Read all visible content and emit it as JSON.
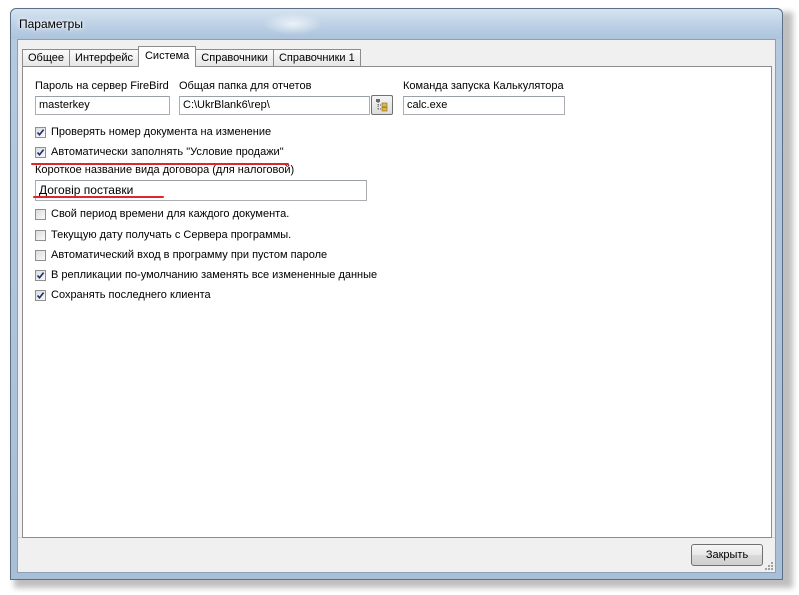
{
  "window": {
    "title": "Параметры"
  },
  "tabs": [
    {
      "label": "Общее",
      "active": false
    },
    {
      "label": "Интерфейс",
      "active": false
    },
    {
      "label": "Система",
      "active": true
    },
    {
      "label": "Справочники",
      "active": false
    },
    {
      "label": "Справочники 1",
      "active": false
    }
  ],
  "fields": {
    "firebird_password": {
      "label": "Пароль на сервер FireBird",
      "value": "masterkey"
    },
    "reports_folder": {
      "label": "Общая папка для отчетов",
      "value": "C:\\UkrBlank6\\rep\\"
    },
    "calculator_command": {
      "label": "Команда запуска Калькулятора",
      "value": "calc.exe"
    },
    "contract_short_name": {
      "label": "Короткое название вида договора (для налоговой)",
      "value": "Договір поставки"
    }
  },
  "checkboxes": [
    {
      "label": "Проверять номер документа на изменение",
      "checked": true
    },
    {
      "label": "Автоматически заполнять \"Условие продажи\"",
      "checked": true
    },
    {
      "label": "Свой период времени для каждого документа.",
      "checked": false
    },
    {
      "label": "Текущую дату получать с Сервера программы.",
      "checked": false
    },
    {
      "label": "Автоматический вход в программу при пустом пароле",
      "checked": false
    },
    {
      "label": "В репликации по-умолчанию заменять все измененные данные",
      "checked": true
    },
    {
      "label": "Сохранять последнего клиента",
      "checked": true
    }
  ],
  "buttons": {
    "close": "Закрыть"
  },
  "colors": {
    "annotation_underline": "#e0262a",
    "title_bar": "#bcd0e5"
  }
}
